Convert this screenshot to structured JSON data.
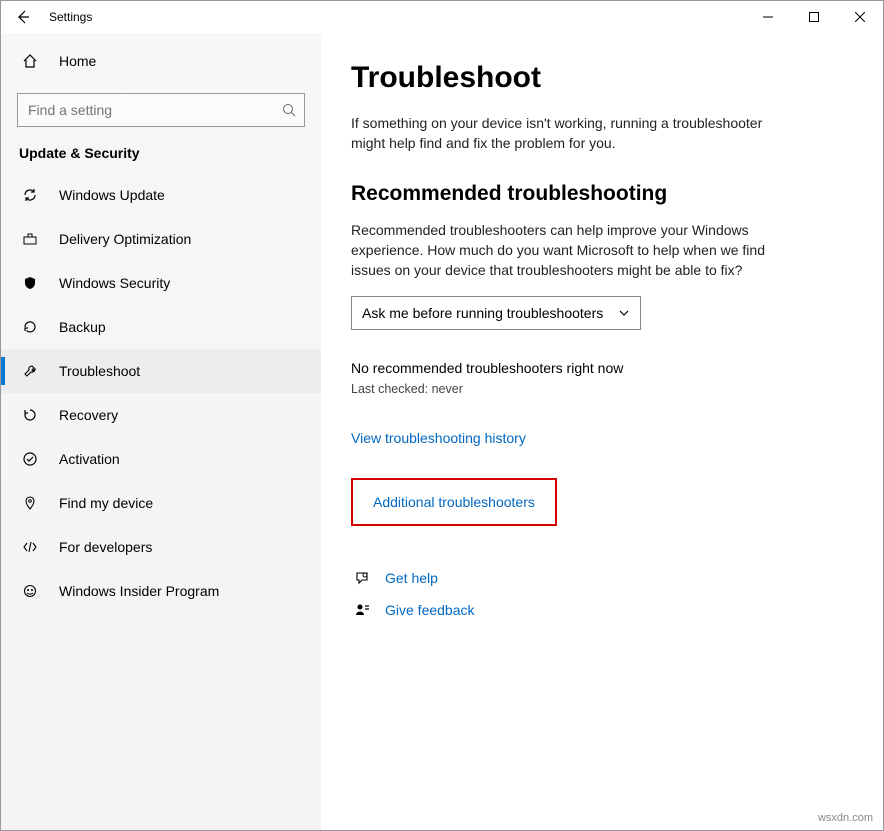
{
  "titlebar": {
    "title": "Settings"
  },
  "sidebar": {
    "home": "Home",
    "search_placeholder": "Find a setting",
    "category": "Update & Security",
    "items": [
      {
        "label": "Windows Update"
      },
      {
        "label": "Delivery Optimization"
      },
      {
        "label": "Windows Security"
      },
      {
        "label": "Backup"
      },
      {
        "label": "Troubleshoot"
      },
      {
        "label": "Recovery"
      },
      {
        "label": "Activation"
      },
      {
        "label": "Find my device"
      },
      {
        "label": "For developers"
      },
      {
        "label": "Windows Insider Program"
      }
    ]
  },
  "main": {
    "title": "Troubleshoot",
    "intro": "If something on your device isn't working, running a troubleshooter might help find and fix the problem for you.",
    "rec_heading": "Recommended troubleshooting",
    "rec_text": "Recommended troubleshooters can help improve your Windows experience. How much do you want Microsoft to help when we find issues on your device that troubleshooters might be able to fix?",
    "dropdown_value": "Ask me before running troubleshooters",
    "no_rec": "No recommended troubleshooters right now",
    "last_checked": "Last checked: never",
    "history_link": "View troubleshooting history",
    "additional_link": "Additional troubleshooters",
    "get_help": "Get help",
    "give_feedback": "Give feedback"
  },
  "watermark": "wsxdn.com"
}
